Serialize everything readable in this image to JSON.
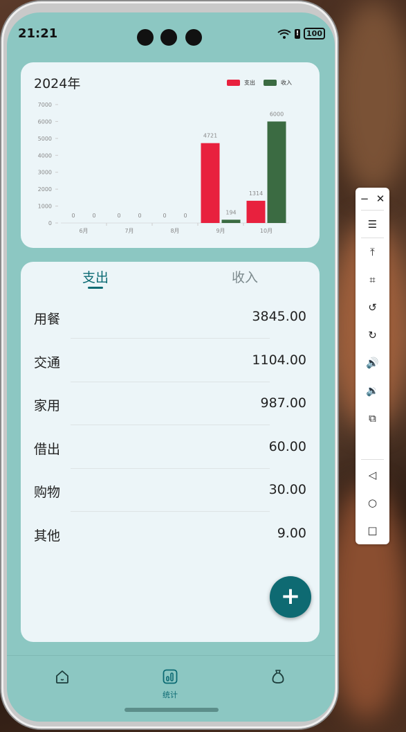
{
  "status_bar": {
    "time": "21:21",
    "battery": "100"
  },
  "chart_card": {
    "title": "2024年"
  },
  "chart_data": {
    "type": "bar",
    "categories": [
      "6月",
      "7月",
      "8月",
      "9月",
      "10月"
    ],
    "series": [
      {
        "name": "支出",
        "color": "#e8213e",
        "values": [
          0,
          0,
          0,
          4721,
          1314
        ]
      },
      {
        "name": "收入",
        "color": "#3b6b42",
        "values": [
          0,
          0,
          0,
          194,
          6000
        ]
      }
    ],
    "y_ticks": [
      0,
      1000,
      2000,
      3000,
      4000,
      5000,
      6000,
      7000
    ],
    "ylim": [
      0,
      7000
    ],
    "legend_position": "top-right"
  },
  "tabs": [
    {
      "label": "支出",
      "active": true
    },
    {
      "label": "收入",
      "active": false
    }
  ],
  "expense_list": [
    {
      "category": "用餐",
      "amount": "3845.00"
    },
    {
      "category": "交通",
      "amount": "1104.00"
    },
    {
      "category": "家用",
      "amount": "987.00"
    },
    {
      "category": "借出",
      "amount": "60.00"
    },
    {
      "category": "购物",
      "amount": "30.00"
    },
    {
      "category": "其他",
      "amount": "9.00"
    }
  ],
  "fab": {
    "icon": "plus-icon",
    "label": "+"
  },
  "bottom_nav": [
    {
      "icon": "home-icon",
      "label": "",
      "active": false
    },
    {
      "icon": "stats-icon",
      "label": "统计",
      "active": true
    },
    {
      "icon": "wallet-bag-icon",
      "label": "",
      "active": false
    }
  ],
  "side_toolbar": [
    {
      "icon": "minimize-icon",
      "symbol": "−"
    },
    {
      "icon": "close-icon",
      "symbol": "✕"
    },
    {
      "icon": "menu-icon",
      "symbol": "☰"
    },
    {
      "icon": "pin-top-icon",
      "symbol": "⤒"
    },
    {
      "icon": "crop-icon",
      "symbol": "⌗"
    },
    {
      "icon": "rotate-left-icon",
      "symbol": "↺"
    },
    {
      "icon": "rotate-right-icon",
      "symbol": "↻"
    },
    {
      "icon": "volume-up-icon",
      "symbol": "🔊"
    },
    {
      "icon": "volume-down-icon",
      "symbol": "🔉"
    },
    {
      "icon": "shake-icon",
      "symbol": "⧉"
    },
    {
      "icon": "back-icon",
      "symbol": "◁"
    },
    {
      "icon": "home-circle-icon",
      "symbol": "○"
    },
    {
      "icon": "recents-icon",
      "symbol": "□"
    }
  ]
}
